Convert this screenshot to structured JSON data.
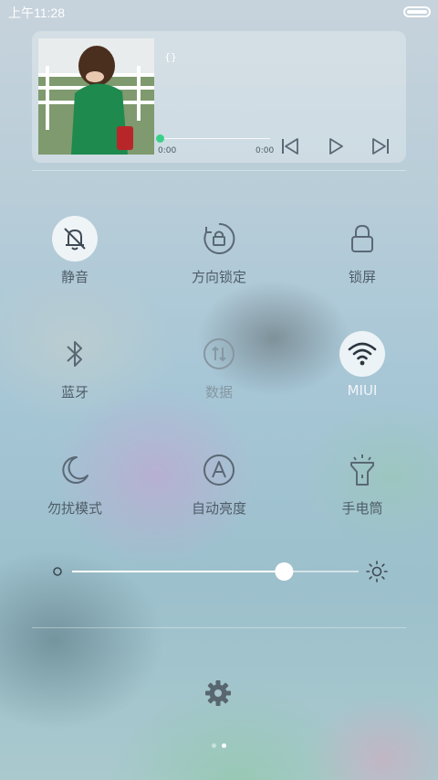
{
  "status_bar": {
    "time": "上午11:28",
    "battery_icon": "battery-icon"
  },
  "music": {
    "title": "{}",
    "current_time": "0:00",
    "total_time": "0:00",
    "progress": 0,
    "accent": "#3bd08a"
  },
  "toggles": [
    {
      "label": "静音",
      "icon": "bell-off-icon",
      "active": true,
      "enabled": true
    },
    {
      "label": "方向锁定",
      "icon": "rotation-lock-icon",
      "active": false,
      "enabled": true
    },
    {
      "label": "锁屏",
      "icon": "lock-icon",
      "active": false,
      "enabled": true
    },
    {
      "label": "蓝牙",
      "icon": "bluetooth-icon",
      "active": false,
      "enabled": true
    },
    {
      "label": "数据",
      "icon": "data-icon",
      "active": false,
      "enabled": false
    },
    {
      "label": "MIUI",
      "icon": "wifi-icon",
      "active": true,
      "enabled": true
    },
    {
      "label": "勿扰模式",
      "icon": "moon-icon",
      "active": false,
      "enabled": true
    },
    {
      "label": "自动亮度",
      "icon": "auto-brightness-icon",
      "active": false,
      "enabled": true
    },
    {
      "label": "手电筒",
      "icon": "flashlight-icon",
      "active": false,
      "enabled": true
    }
  ],
  "brightness": {
    "level": 0.74,
    "min_icon": "brightness-low-icon",
    "max_icon": "brightness-high-icon"
  },
  "settings_icon": "gear-icon",
  "page_indicator": {
    "count": 2,
    "current": 2
  }
}
